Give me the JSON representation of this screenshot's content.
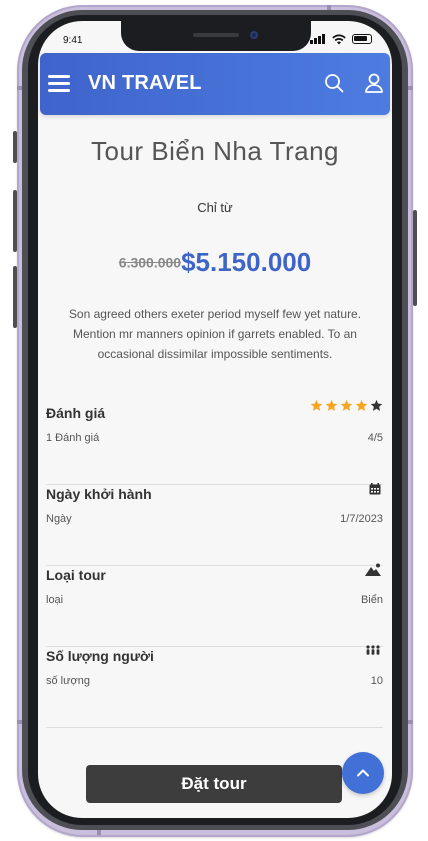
{
  "status_bar": {
    "time": "9:41"
  },
  "header": {
    "brand": "VN TRAVEL",
    "icons": [
      "menu-icon",
      "search-icon",
      "user-icon"
    ],
    "gradient": [
      "#3f64cc",
      "#4d7ce0"
    ]
  },
  "tour": {
    "title": "Tour Biển Nha Trang",
    "from_label": "Chỉ từ",
    "old_price": "6.300.000",
    "new_price": "$5.150.000",
    "description": "Son agreed others exeter period myself few yet nature. Mention mr manners opinion if garrets enabled. To an occasional dissimilar impossible sentiments."
  },
  "info": {
    "rating": {
      "title": "Đánh giá",
      "sub": "1 Đánh giá",
      "value": "4/5",
      "stars_filled": 4,
      "stars_total": 5,
      "icon": "star-icon"
    },
    "departure": {
      "title": "Ngày khởi hành",
      "sub": "Ngày",
      "value": "1/7/2023",
      "icon": "calendar-icon"
    },
    "tour_type": {
      "title": "Loại tour",
      "sub": "loại",
      "value": "Biển",
      "icon": "mountain-icon"
    },
    "people": {
      "title": "Số lượng người",
      "sub": "số lượng",
      "value": "10",
      "icon": "people-icon"
    }
  },
  "actions": {
    "book_label": "Đặt tour",
    "scroll_top_icon": "chevron-up-icon"
  },
  "colors": {
    "accent": "#3f64c8",
    "star": "#f5a623",
    "star_empty": "#333333",
    "button": "#3d3d3d"
  }
}
